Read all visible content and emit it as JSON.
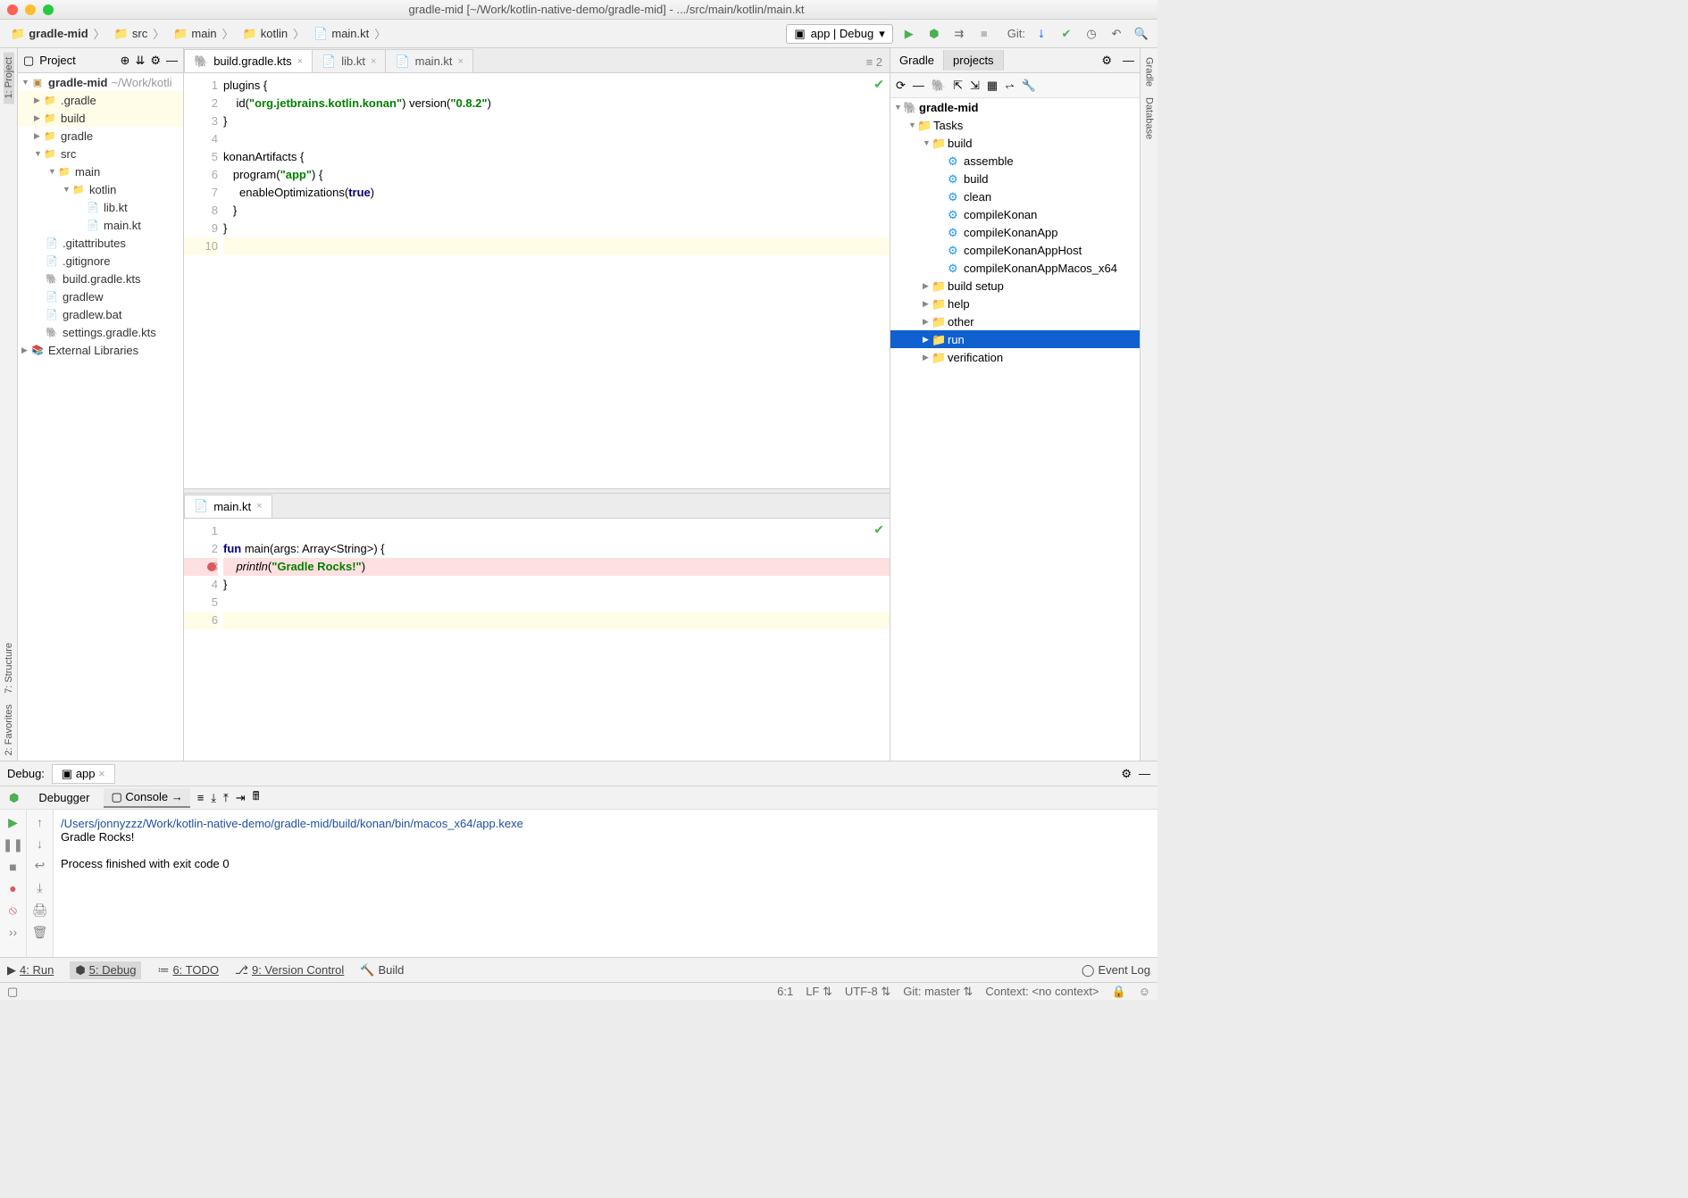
{
  "title": "gradle-mid [~/Work/kotlin-native-demo/gradle-mid] - .../src/main/kotlin/main.kt",
  "breadcrumbs": [
    "gradle-mid",
    "src",
    "main",
    "kotlin",
    "main.kt"
  ],
  "run_config": "app | Debug",
  "git_label": "Git:",
  "left_tabs": [
    "1: Project",
    "7: Structure",
    "2: Favorites"
  ],
  "right_tabs": [
    "Gradle",
    "Database"
  ],
  "project_pane": {
    "title": "Project"
  },
  "tree": {
    "root": {
      "name": "gradle-mid",
      "path": "~/Work/kotli"
    },
    "folders": [
      ".gradle",
      "build",
      "gradle",
      "src"
    ],
    "main": "main",
    "kotlin": "kotlin",
    "kfiles": [
      "lib.kt",
      "main.kt"
    ],
    "rootfiles": [
      ".gitattributes",
      ".gitignore",
      "build.gradle.kts",
      "gradlew",
      "gradlew.bat",
      "settings.gradle.kts"
    ],
    "extlib": "External Libraries"
  },
  "editor_tabs": [
    {
      "name": "build.gradle.kts",
      "active": true
    },
    {
      "name": "lib.kt",
      "active": false
    },
    {
      "name": "main.kt",
      "active": false
    }
  ],
  "split_indicator": "≡ 2",
  "editor1": {
    "lines": [
      "plugins {",
      "    id(\"org.jetbrains.kotlin.konan\") version(\"0.8.2\")",
      "}",
      "",
      "konanArtifacts {",
      "   program(\"app\") {",
      "     enableOptimizations(true)",
      "   }",
      "}",
      ""
    ]
  },
  "editor2_tab": "main.kt",
  "editor2": {
    "lines": [
      "",
      "fun main(args: Array<String>) {",
      "    println(\"Gradle Rocks!\")",
      "}",
      "",
      ""
    ]
  },
  "gradle_tabs": [
    "Gradle",
    "projects"
  ],
  "gradle_tree": {
    "root": "gradle-mid",
    "tasks": "Tasks",
    "build": "build",
    "build_tasks": [
      "assemble",
      "build",
      "clean",
      "compileKonan",
      "compileKonanApp",
      "compileKonanAppHost",
      "compileKonanAppMacos_x64"
    ],
    "groups": [
      "build setup",
      "help",
      "other",
      "run",
      "verification"
    ]
  },
  "debug": {
    "title": "Debug:",
    "tab": "app",
    "tabs": [
      "Debugger",
      "Console"
    ],
    "console_path": "/Users/jonnyzzz/Work/kotlin-native-demo/gradle-mid/build/konan/bin/macos_x64/app.kexe",
    "output": "Gradle Rocks!",
    "exit": "Process finished with exit code 0"
  },
  "bottom": [
    {
      "icon": "▶",
      "label": "4: Run"
    },
    {
      "icon": "⬢",
      "label": "5: Debug",
      "active": true
    },
    {
      "icon": "≔",
      "label": "6: TODO"
    },
    {
      "icon": "⎇",
      "label": "9: Version Control"
    },
    {
      "icon": "🔨",
      "label": "Build"
    }
  ],
  "event_log": "Event Log",
  "status": {
    "pos": "6:1",
    "le": "LF",
    "enc": "UTF-8",
    "git": "Git: master",
    "ctx": "Context: <no context>"
  }
}
